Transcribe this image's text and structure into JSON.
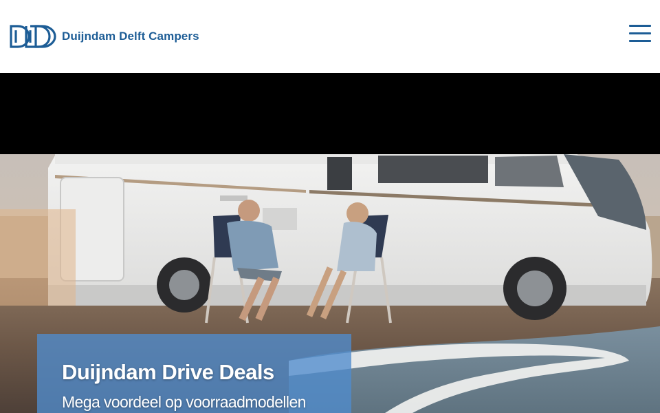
{
  "header": {
    "brand_name": "Duijndam Delft Campers",
    "logo_icon": "dd-logo-icon",
    "menu_icon": "hamburger-menu-icon",
    "brand_color": "#1d5d96"
  },
  "hero": {
    "image": "campervan-beach-couple-image",
    "promo": {
      "title": "Duijndam Drive Deals",
      "subtitle": "Mega voordeel op voorraadmodellen",
      "background_color": "#508ccd"
    }
  }
}
